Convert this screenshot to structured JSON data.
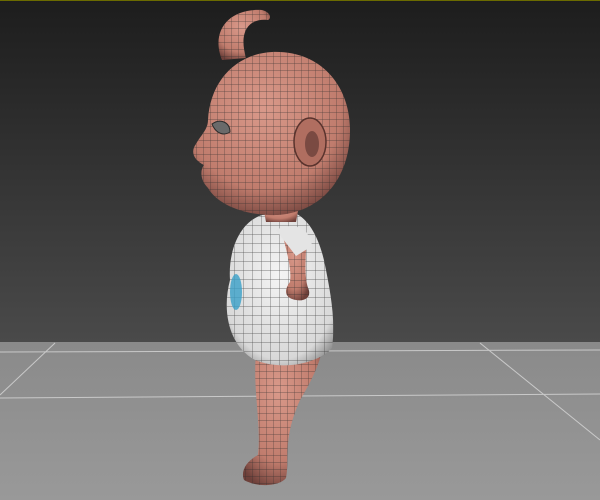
{
  "viewport": {
    "active_border_color": "#6b6b00",
    "background_top": "#1d1d1d",
    "background_bottom": "#4a4a4a",
    "floor_color": "#8e8e8e",
    "floor_grid_color": "#d8d8d8",
    "skin_color": "#c88576",
    "skin_shadow": "#7a4a42",
    "onesie_color": "#e9e9e9",
    "onesie_accent": "#3aa0c8",
    "wire_color": "#2a2a2a"
  },
  "scene": {
    "object": "baby-character-wireframe",
    "view": "side"
  }
}
